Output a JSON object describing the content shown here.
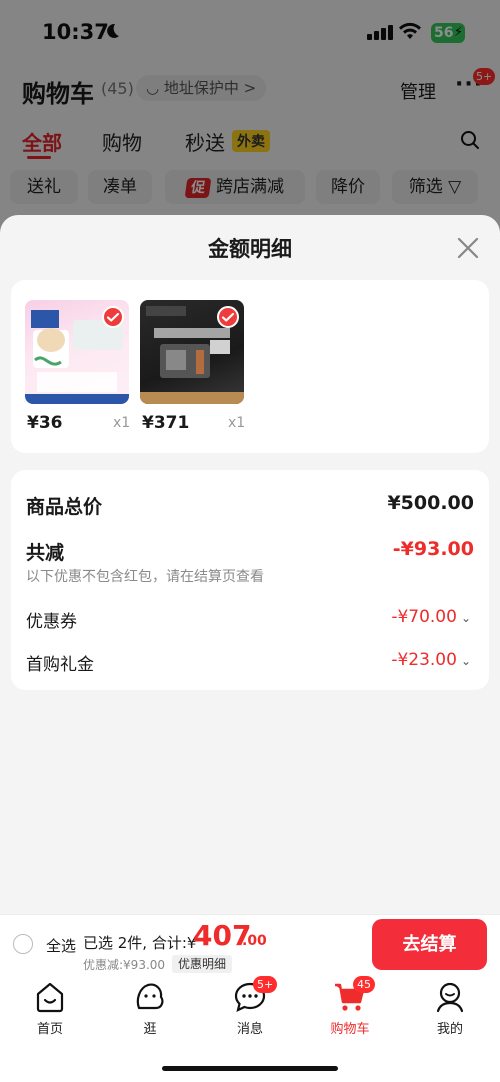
{
  "status_bar": {
    "time": "10:37",
    "battery": "56"
  },
  "cart": {
    "title": "购物车",
    "count": "(45)",
    "address_pill": "◡ 地址保护中 >",
    "manage": "管理",
    "more_badge": "5+",
    "tabs": [
      "全部",
      "购物",
      "秒送"
    ],
    "takeaway_tag": "外卖",
    "filters": [
      "送礼",
      "凑单",
      "跨店满减",
      "降价",
      "筛选 ▽"
    ],
    "promo_tag": "促"
  },
  "sheet": {
    "title": "金额明细",
    "products": [
      {
        "price": "¥36",
        "qty": "x1"
      },
      {
        "price": "¥371",
        "qty": "x1"
      }
    ],
    "summary": {
      "total_label": "商品总价",
      "total_value": "¥500.00",
      "reduce_label": "共减",
      "reduce_value": "-¥93.00",
      "note": "以下优惠不包含红包，请在结算页查看",
      "coupon_label": "优惠券",
      "coupon_value": "-¥70.00",
      "gift_label": "首购礼金",
      "gift_value": "-¥23.00"
    }
  },
  "checkout": {
    "select_all": "全选",
    "selected": "已选 2件, 合计:¥",
    "total_int": "407",
    "total_dec": ".00",
    "discount": "优惠减:¥93.00",
    "detail": "优惠明细",
    "button": "去结算"
  },
  "tabbar": {
    "items": [
      {
        "label": "首页",
        "badge": ""
      },
      {
        "label": "逛",
        "badge": ""
      },
      {
        "label": "消息",
        "badge": "5+"
      },
      {
        "label": "购物车",
        "badge": "45"
      },
      {
        "label": "我的",
        "badge": ""
      }
    ]
  },
  "colors": {
    "accent": "#ee2c2c",
    "checkout_button": "#f42d3b",
    "takeaway": "#ffd21f"
  }
}
